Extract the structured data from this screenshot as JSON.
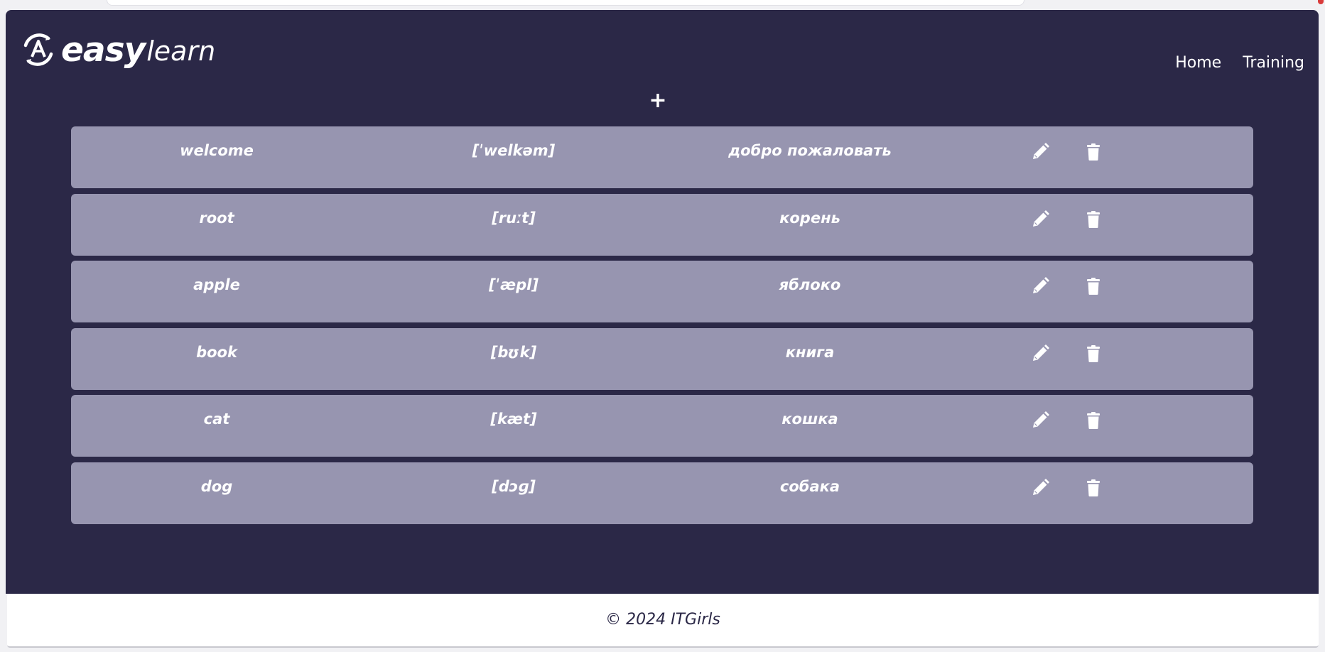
{
  "brand": {
    "logo_icon": "circle-a-icon",
    "name_bold": "easy",
    "name_light": "learn"
  },
  "nav": {
    "items": [
      {
        "label": "Home"
      },
      {
        "label": "Training"
      }
    ]
  },
  "toolbar": {
    "add_label": "+"
  },
  "words": [
    {
      "word": "welcome",
      "transcription": "[ˈwelkəm]",
      "translation": "добро пожаловать"
    },
    {
      "word": "root",
      "transcription": "[ruːt]",
      "translation": "корень"
    },
    {
      "word": "apple",
      "transcription": "[ˈæpl]",
      "translation": "яблоко"
    },
    {
      "word": "book",
      "transcription": "[bʊk]",
      "translation": "книга"
    },
    {
      "word": "cat",
      "transcription": "[kæt]",
      "translation": "кошка"
    },
    {
      "word": "dog",
      "transcription": "[dɔɡ]",
      "translation": "собака"
    }
  ],
  "row_icons": {
    "edit": "pencil-icon",
    "delete": "trash-icon"
  },
  "footer": {
    "copyright": "© 2024 ITGirls"
  },
  "colors": {
    "background": "#2b2847",
    "card": "#9795b0",
    "text": "#ffffff",
    "footer_bg": "#ffffff"
  }
}
